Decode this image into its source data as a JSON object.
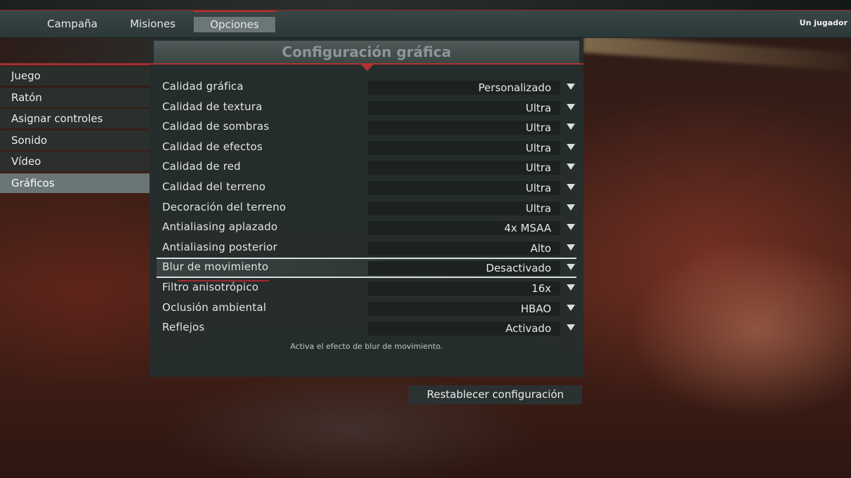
{
  "topbar": {
    "tabs": [
      {
        "label": "Campaña"
      },
      {
        "label": "Misiones"
      },
      {
        "label": "Opciones"
      }
    ],
    "active_tab": "Opciones",
    "player_mode": "Un jugador"
  },
  "sidebar": {
    "items": [
      {
        "label": "Juego"
      },
      {
        "label": "Ratón"
      },
      {
        "label": "Asignar controles"
      },
      {
        "label": "Sonido"
      },
      {
        "label": "Vídeo"
      },
      {
        "label": "Gráficos"
      }
    ],
    "active_item": "Gráficos"
  },
  "panel": {
    "title": "Configuración gráfica",
    "settings": [
      {
        "label": "Calidad gráfica",
        "value": "Personalizado"
      },
      {
        "label": "Calidad de textura",
        "value": "Ultra"
      },
      {
        "label": "Calidad de sombras",
        "value": "Ultra"
      },
      {
        "label": "Calidad de efectos",
        "value": "Ultra"
      },
      {
        "label": "Calidad de red",
        "value": "Ultra"
      },
      {
        "label": "Calidad del terreno",
        "value": "Ultra"
      },
      {
        "label": "Decoración del terreno",
        "value": "Ultra"
      },
      {
        "label": "Antialiasing aplazado",
        "value": "4x MSAA"
      },
      {
        "label": "Antialiasing posterior",
        "value": "Alto"
      },
      {
        "label": "Blur de movimiento",
        "value": "Desactivado"
      },
      {
        "label": "Filtro anisotrópico",
        "value": "16x"
      },
      {
        "label": "Oclusión ambiental",
        "value": "HBAO"
      },
      {
        "label": "Reflejos",
        "value": "Activado"
      }
    ],
    "selected_setting": "Blur de movimiento",
    "description": "Activa el efecto de blur de movimiento."
  },
  "footer": {
    "reset_label": "Restablecer configuración"
  },
  "colors": {
    "accent_red": "#b23232",
    "panel_bg": "#242e2e",
    "active_bg": "#6a7575"
  }
}
